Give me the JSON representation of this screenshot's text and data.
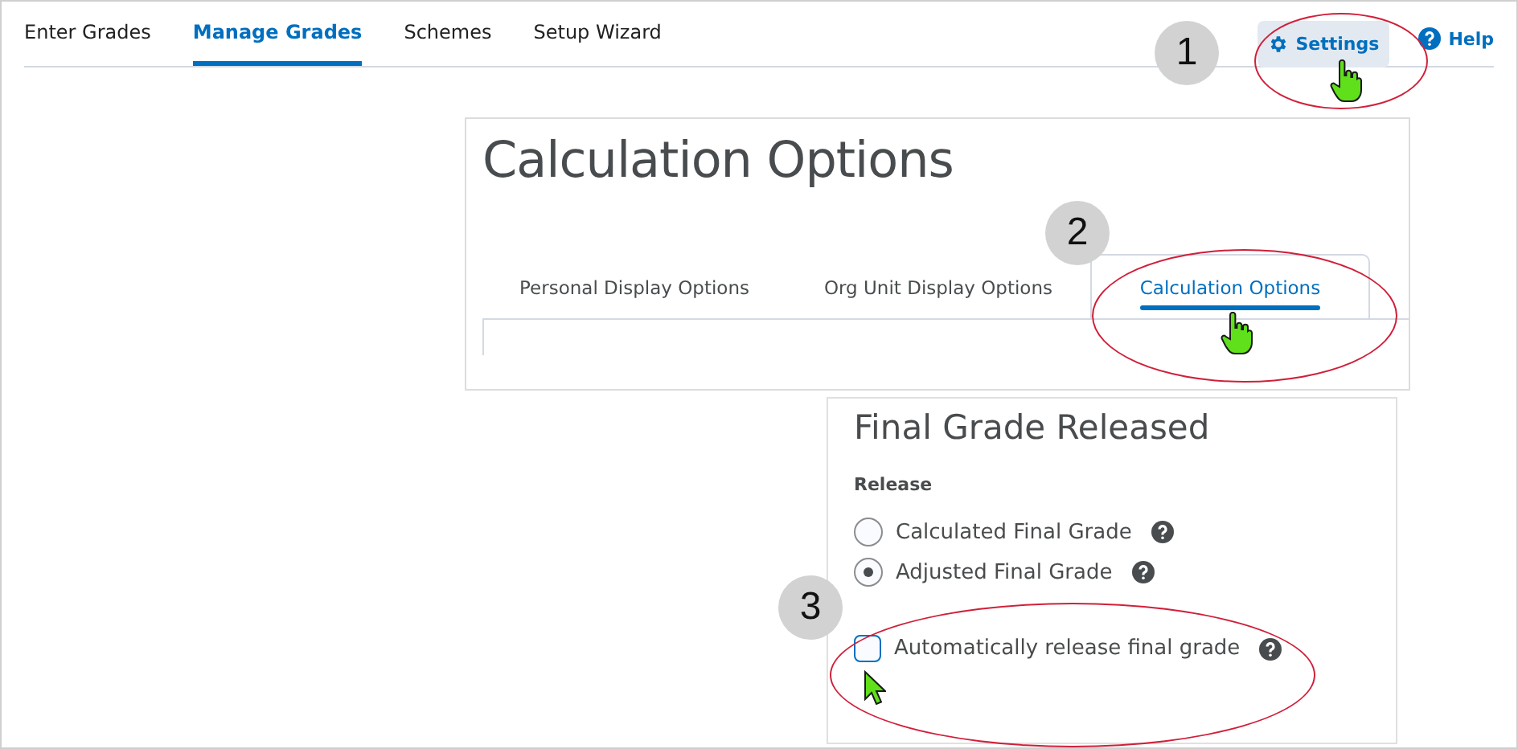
{
  "nav_tabs": [
    {
      "label": "Enter Grades",
      "selected": false
    },
    {
      "label": "Manage Grades",
      "selected": true
    },
    {
      "label": "Schemes",
      "selected": false
    },
    {
      "label": "Setup Wizard",
      "selected": false
    }
  ],
  "settings_button": "Settings",
  "help_link": "Help",
  "page_title": "Calculation Options",
  "sub_tabs": [
    {
      "label": "Personal Display Options",
      "selected": false
    },
    {
      "label": "Org Unit Display Options",
      "selected": false
    },
    {
      "label": "Calculation Options",
      "selected": true
    }
  ],
  "section_title": "Final Grade Released",
  "release_label": "Release",
  "release_options": [
    {
      "label": "Calculated Final Grade",
      "selected": false
    },
    {
      "label": "Adjusted Final Grade",
      "selected": true
    }
  ],
  "auto_release": {
    "label": "Automatically release final grade",
    "checked": false
  },
  "steps": [
    "1",
    "2",
    "3"
  ]
}
